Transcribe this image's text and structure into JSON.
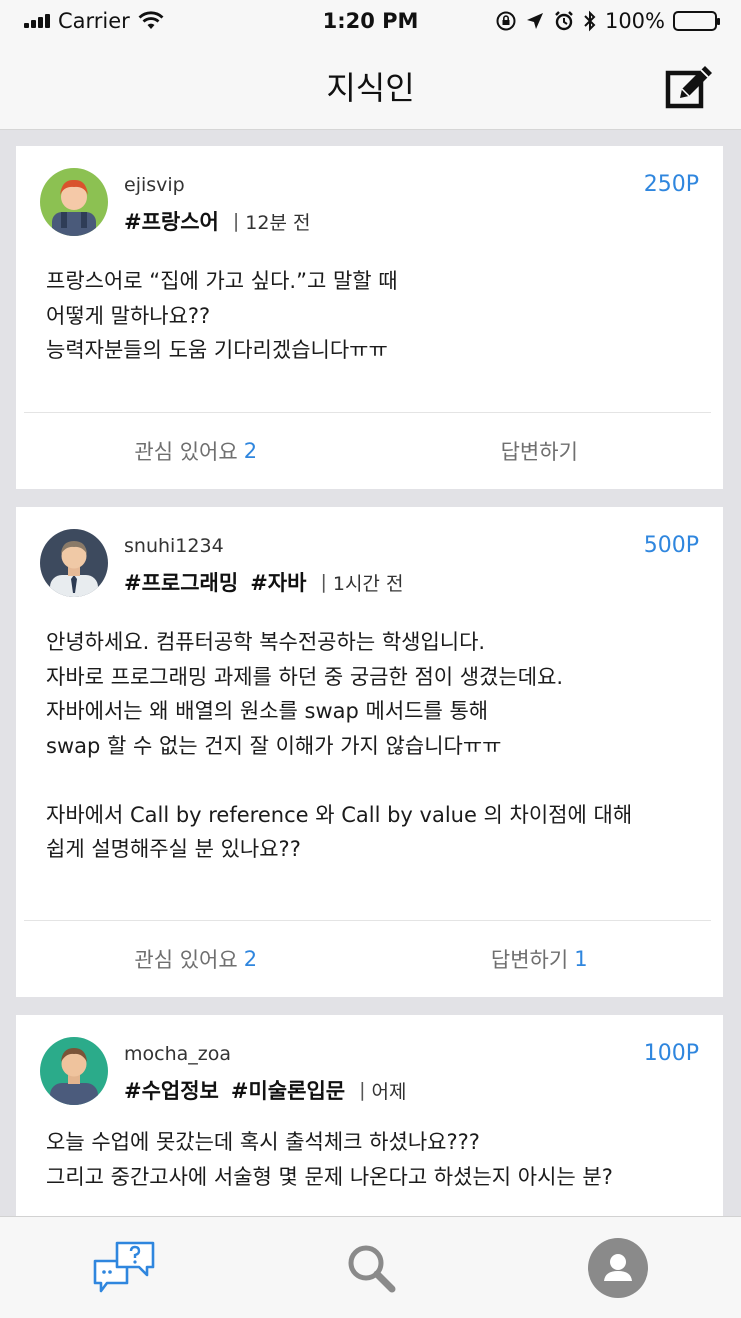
{
  "status_bar": {
    "carrier": "Carrier",
    "time": "1:20 PM",
    "battery": "100%"
  },
  "nav": {
    "title": "지식인"
  },
  "posts": [
    {
      "username": "ejisvip",
      "tags": [
        "#프랑스어"
      ],
      "time": "12분 전",
      "points": "250P",
      "lines": [
        "프랑스어로 “집에 가고 싶다.”고 말할 때",
        "어떻게 말하나요??",
        "능력자분들의 도움 기다리겠습니다ㅠㅠ"
      ],
      "interest_label": "관심 있어요",
      "interest_count": "2",
      "answer_label": "답변하기",
      "answer_count": ""
    },
    {
      "username": "snuhi1234",
      "tags": [
        "#프로그래밍",
        "#자바"
      ],
      "time": "1시간 전",
      "points": "500P",
      "lines": [
        "안녕하세요. 컴퓨터공학 복수전공하는 학생입니다.",
        "자바로 프로그래밍 과제를 하던 중 궁금한 점이 생겼는데요.",
        "자바에서는 왜 배열의 원소를 swap 메서드를 통해",
        "swap 할 수 없는 건지 잘 이해가 가지 않습니다ㅠㅠ",
        "",
        "자바에서 Call by reference 와 Call by value 의 차이점에 대해",
        "쉽게 설명해주실 분 있나요??"
      ],
      "interest_label": "관심 있어요",
      "interest_count": "2",
      "answer_label": "답변하기",
      "answer_count": "1"
    },
    {
      "username": "mocha_zoa",
      "tags": [
        "#수업정보",
        "#미술론입문"
      ],
      "time": "어제",
      "points": "100P",
      "lines": [
        "오늘 수업에 못갔는데 혹시 출석체크 하셨나요???",
        "그리고 중간고사에 서술형 몇 문제 나온다고 하셨는지 아시는 분?"
      ],
      "interest_label": "",
      "interest_count": "",
      "answer_label": "",
      "answer_count": ""
    }
  ],
  "colors": {
    "accent": "#2f86de",
    "background": "#e2e2e6",
    "card": "#ffffff"
  }
}
